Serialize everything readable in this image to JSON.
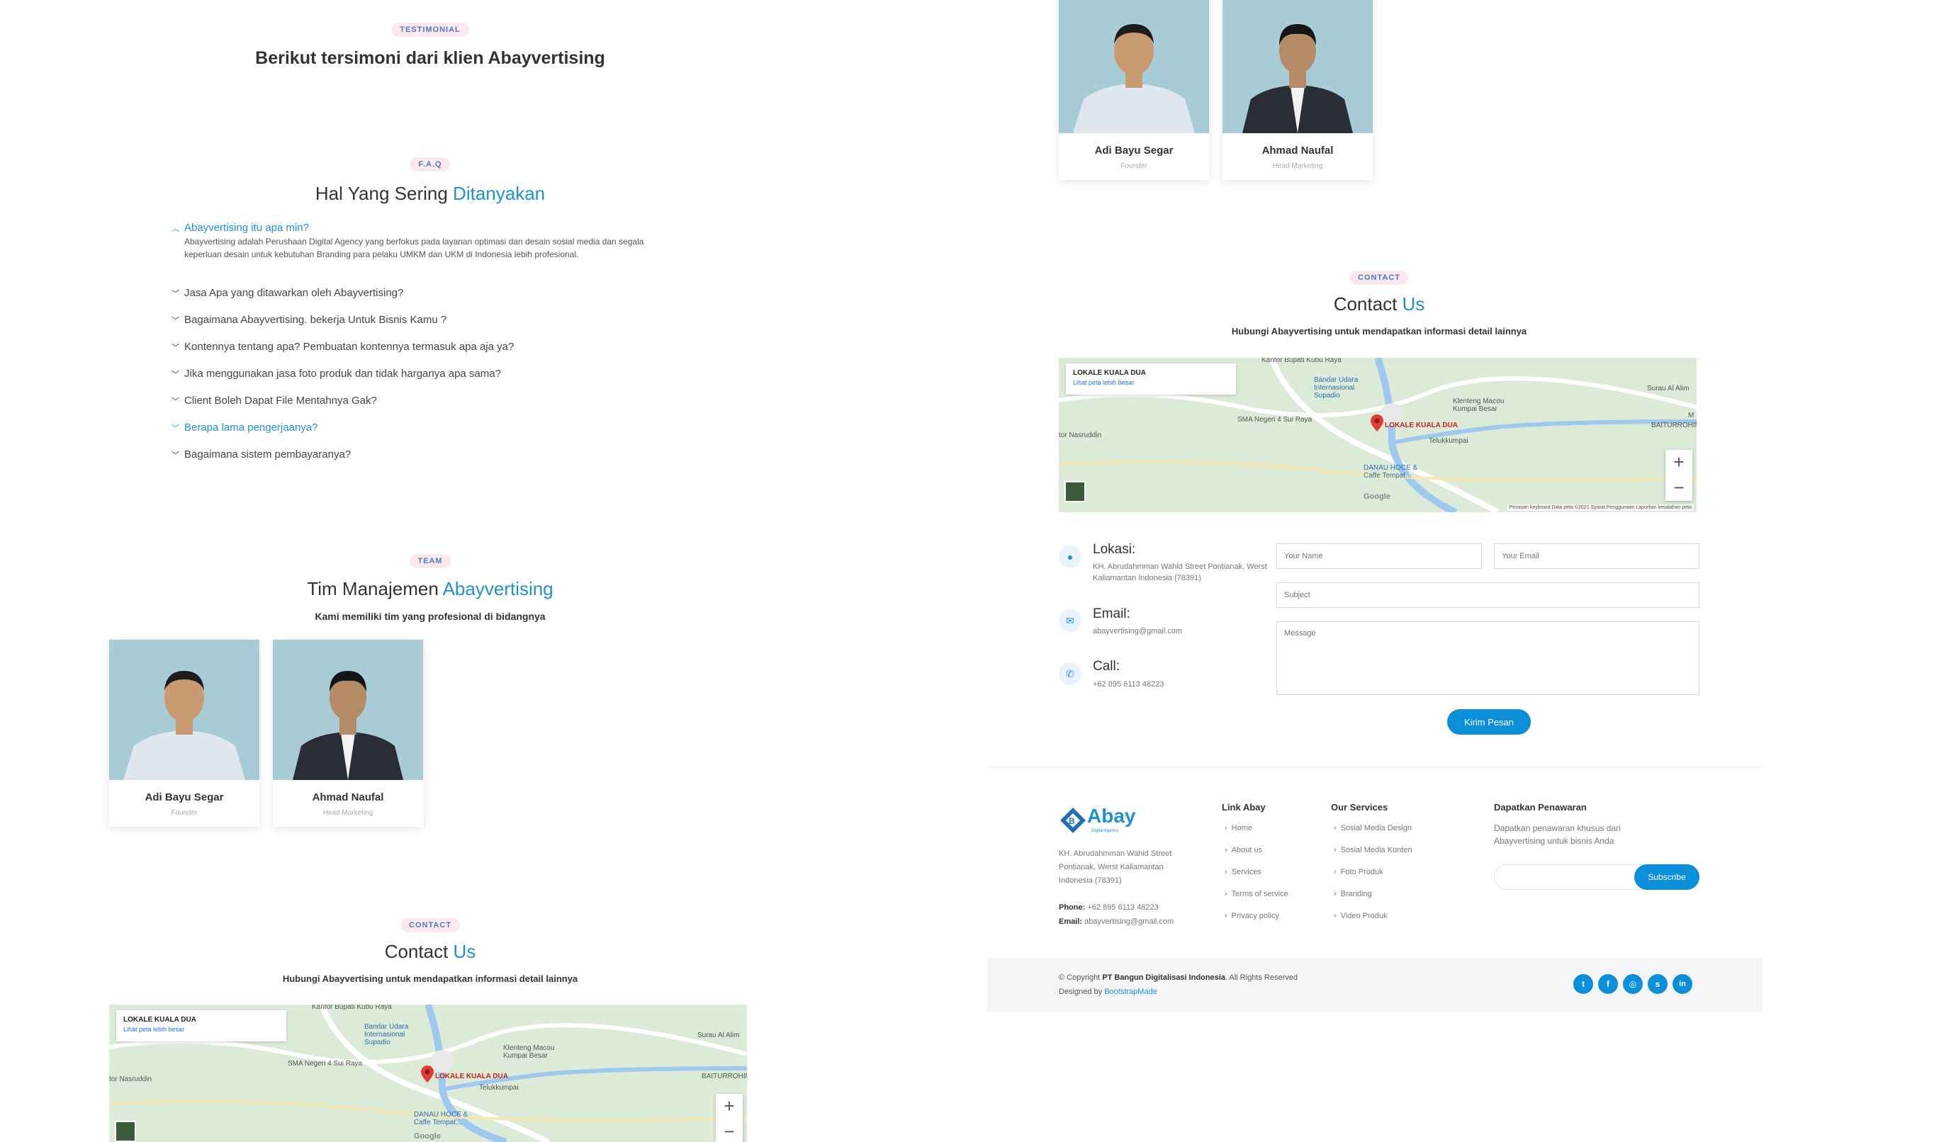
{
  "testimonial": {
    "badge": "TESTIMONIAL",
    "title": "Berikut tersimoni dari klien Abayvertising"
  },
  "faq": {
    "badge": "F.A.Q",
    "title_plain": "Hal Yang Sering ",
    "title_accent": "Ditanyakan",
    "items": [
      {
        "question": "Abayvertising itu apa min?",
        "answer": "Abayvertising adalah Perushaan Digital Agency yang berfokus pada layanan optimasi dan desain sosial media dan segala keperluan desain untuk kebutuhan Branding para pelaku UMKM dan UKM di Indonesia lebih profesional.",
        "state": "expanded"
      },
      {
        "question": "Jasa Apa yang ditawarkan oleh Abayvertising?",
        "state": "collapsed"
      },
      {
        "question": "Bagaimana Abayvertising. bekerja Untuk Bisnis Kamu ?",
        "state": "collapsed"
      },
      {
        "question": "Kontennya tentang apa? Pembuatan kontennya termasuk apa aja ya?",
        "state": "collapsed"
      },
      {
        "question": "Jika menggunakan jasa foto produk dan tidak harganya apa sama?",
        "state": "collapsed"
      },
      {
        "question": "Client Boleh Dapat File Mentahnya Gak?",
        "state": "collapsed"
      },
      {
        "question": "Berapa lama pengerjaanya?",
        "state": "hover"
      },
      {
        "question": "Bagaimana sistem pembayaranya?",
        "state": "collapsed"
      }
    ]
  },
  "team": {
    "badge": "TEAM",
    "title_plain": "Tim Manajemen ",
    "title_accent": "Abayvertising",
    "subtitle": "Kami memiliki tim yang profesional di bidangnya",
    "members": [
      {
        "name": "Adi Bayu Segar",
        "role": "Founder"
      },
      {
        "name": "Ahmad Naufal",
        "role": "Head Marketing"
      }
    ]
  },
  "contact": {
    "badge": "CONTACT",
    "title_plain": "Contact ",
    "title_accent": "Us",
    "subtitle": "Hubungi Abayvertising untuk mendapatkan informasi detail lainnya",
    "map": {
      "place_name": "LOKALE KUALA DUA",
      "larger_map_link": "Lihat peta lebih besar",
      "labels": {
        "kantor": "Kantor Bupati Kubu Raya",
        "bandara": "Bandar Udara Internasional Supadio",
        "klenteng": "Klenteng Macou Kumpai Besar",
        "surau": "Surau Al Alim",
        "sma": "SMA Negeri 4 Sui Raya",
        "nasruddin": "tor Nasruddin",
        "marker": "LOKALE KUALA DUA",
        "teluk": "Telukkumpai",
        "baiturrohim": "BAITURROHIM",
        "danau": "DANAU HOCE & Caffe Tempat...",
        "m": "M"
      },
      "attribution": "Pintasan keyboard   Data peta ©2021   Syarat Penggunaan   Laporkan kesalahan peta",
      "google": "Google"
    },
    "info": {
      "location_title": "Lokasi:",
      "location_text": "KH. Abrudahmman Wahid Street Pontianak, Werst Kaliamantan Indonesia (78391)",
      "email_title": "Email:",
      "email_text": "abayvertising@gmail.com",
      "call_title": "Call:",
      "call_text": "+62 895 6113 48223"
    },
    "form": {
      "name_placeholder": "Your Name",
      "email_placeholder": "Your Email",
      "subject_placeholder": "Subject",
      "message_placeholder": "Message",
      "submit_label": "Kirim Pesan"
    }
  },
  "footer": {
    "logo_text": "Abay",
    "logo_tagline": "Digital Agency",
    "address": "KH. Abrudahmman Wahid Street Pontianak, Werst Kaliamantan Indonesia (78391)",
    "phone_label": "Phone:",
    "phone_value": " +62 895 6113 48223",
    "email_label": "Email:",
    "email_value": " abayvertising@gmail.com",
    "links_title": "Link Abay",
    "links": [
      "Home",
      "About us",
      "Services",
      "Terms of service",
      "Privacy policy"
    ],
    "services_title": "Our Services",
    "services": [
      "Sosial Media Design",
      "Sosial Media Konten",
      "Foto Produk",
      "Branding",
      "Video Produk"
    ],
    "newsletter_title": "Dapatkan Penawaran",
    "newsletter_text": "Dapatkan penawaran khusus dari Abayvertising untuk bisnis Anda",
    "subscribe_label": "Subscribe",
    "copyright_prefix": "© Copyright ",
    "copyright_company": "PT Bangun Digitalisasi Indonesia",
    "copyright_suffix": ". All Rights Reserved",
    "designed_prefix": "Designed by ",
    "designed_link": "BootstrapMade",
    "social": [
      "twitter-icon",
      "facebook-icon",
      "instagram-icon",
      "skype-icon",
      "linkedin-icon"
    ]
  },
  "colors": {
    "accent": "#1e90d6",
    "button": "#0a8fd8",
    "badge_bg": "#fde8ee",
    "photo_bg": "#a7ccd6"
  }
}
